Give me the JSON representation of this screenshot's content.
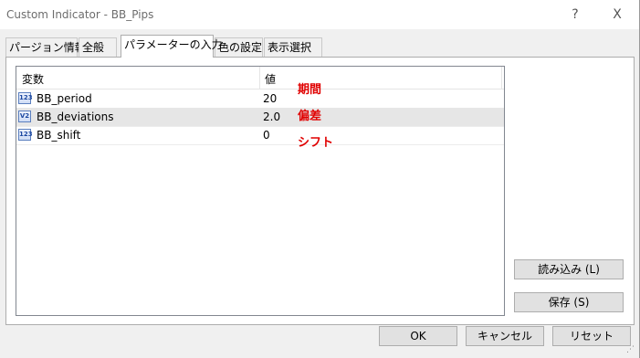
{
  "window": {
    "title": "Custom Indicator - BB_Pips",
    "help_icon": "?",
    "close_icon": "X"
  },
  "tabs": [
    {
      "label": "パージョン情報"
    },
    {
      "label": "全般"
    },
    {
      "label": "パラメーターの入力",
      "active": true
    },
    {
      "label": "色の設定"
    },
    {
      "label": "表示選択"
    }
  ],
  "table": {
    "col_name": "変数",
    "col_value": "値",
    "rows": [
      {
        "icon": "123",
        "name": "BB_period",
        "value": "20",
        "note": "期間"
      },
      {
        "icon": "V2",
        "name": "BB_deviations",
        "value": "2.0",
        "note": "偏差",
        "selected": true
      },
      {
        "icon": "123",
        "name": "BB_shift",
        "value": "0",
        "note": "シフト"
      }
    ]
  },
  "side_buttons": {
    "load": "読み込み (L)",
    "save": "保存 (S)"
  },
  "footer_buttons": {
    "ok": "OK",
    "cancel": "キャンセル",
    "reset": "リセット"
  },
  "colors": {
    "annotation": "#e00000",
    "selected_row": "#e6e6e6"
  }
}
